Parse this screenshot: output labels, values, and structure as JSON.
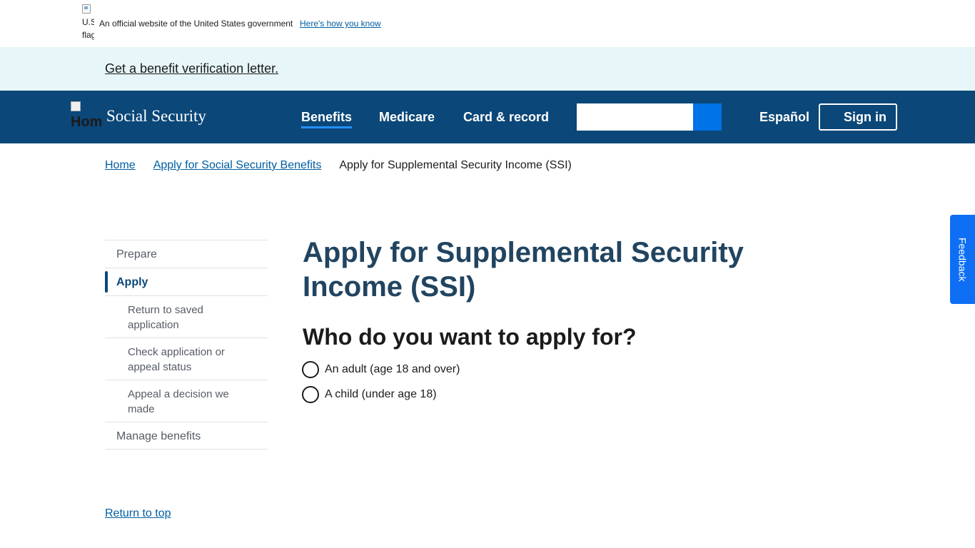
{
  "gov_banner": {
    "flag_alt_line1": "U.S.",
    "flag_alt_line2": "flag",
    "text": "An official website of the United States government",
    "link": "Here's how you know"
  },
  "alert": {
    "link": "Get a benefit verification letter."
  },
  "header": {
    "logo_alt": "Home",
    "site_name": "Social Security",
    "nav": {
      "benefits": "Benefits",
      "medicare": "Medicare",
      "card_record": "Card & record"
    },
    "search": {
      "value": "",
      "placeholder": ""
    },
    "espanol": "Español",
    "sign_in": "Sign in"
  },
  "breadcrumb": {
    "home": "Home",
    "parent": "Apply for Social Security Benefits",
    "current": "Apply for Supplemental Security Income (SSI)"
  },
  "sidenav": {
    "prepare": "Prepare",
    "apply": "Apply",
    "return_saved": "Return to saved application",
    "check_status": "Check application or appeal status",
    "appeal": "Appeal a decision we made",
    "manage": "Manage benefits"
  },
  "main": {
    "title": "Apply for Supplemental Security Income (SSI)",
    "question": "Who do you want to apply for?",
    "option_adult": "An adult (age 18 and over)",
    "option_child": "A child (under age 18)"
  },
  "footer": {
    "return_top": "Return to top"
  },
  "feedback": "Feedback",
  "colors": {
    "header_bg": "#0b4778",
    "alert_bg": "#e7f6f8",
    "link": "#005ea2",
    "title": "#214460",
    "search_button": "#0073e6",
    "feedback_bg": "#0f6ff4"
  }
}
